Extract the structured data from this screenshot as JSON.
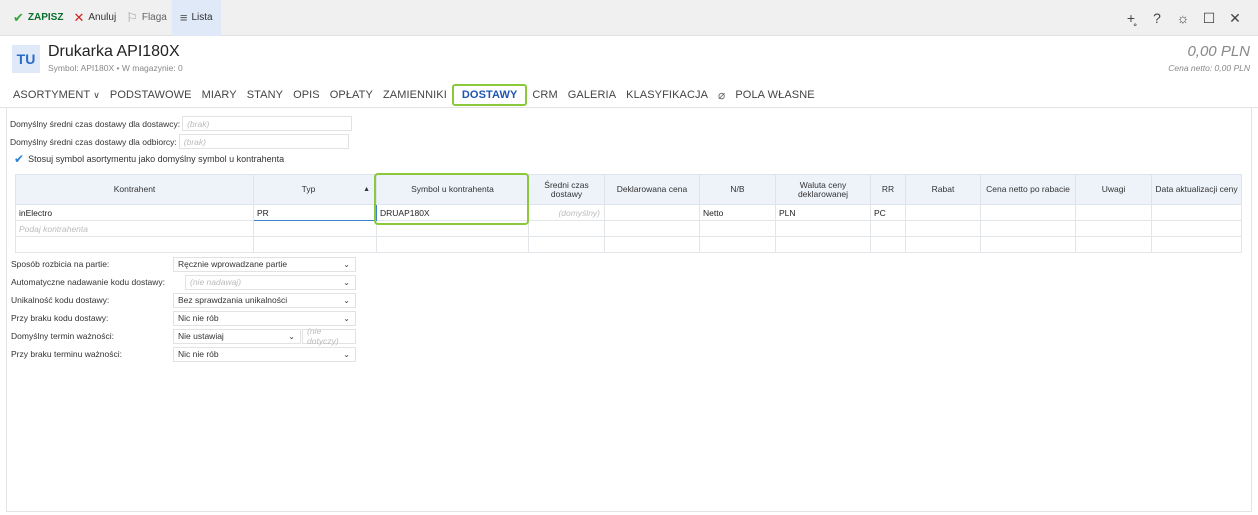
{
  "toolbar": {
    "save": "ZAPISZ",
    "cancel": "Anuluj",
    "flag": "Flaga",
    "list": "Lista"
  },
  "header": {
    "avatar": "TU",
    "title": "Drukarka API180X",
    "subtitle": "Symbol: API180X • W magazynie: 0",
    "price": "0,00 PLN",
    "price_sub": "Cena netto: 0,00 PLN"
  },
  "tabs": [
    "ASORTYMENT",
    "PODSTAWOWE",
    "MIARY",
    "STANY",
    "OPIS",
    "OPŁATY",
    "ZAMIENNIKI",
    "DOSTAWY",
    "CRM",
    "GALERIA",
    "KLASYFIKACJA",
    "POLA WŁASNE"
  ],
  "settings": {
    "supplier_time_label": "Domyślny średni czas dostawy dla dostawcy:",
    "supplier_time_value": "(brak)",
    "receiver_time_label": "Domyślny średni czas dostawy dla odbiorcy:",
    "receiver_time_value": "(brak)",
    "use_symbol_label": "Stosuj symbol asortymentu jako domyślny symbol u kontrahenta"
  },
  "table": {
    "headers": [
      "Kontrahent",
      "Typ",
      "Symbol u kontrahenta",
      "Średni czas dostawy",
      "Deklarowana cena",
      "N/B",
      "Waluta ceny deklarowanej",
      "RR",
      "Rabat",
      "Cena netto po rabacie",
      "Uwagi",
      "Data aktualizacji ceny"
    ],
    "row": {
      "kontrahent": "inElectro",
      "typ": "PR",
      "symbol": "DRUAP180X",
      "czas": "(domyślny)",
      "nb": "Netto",
      "waluta": "PLN",
      "rr": "PC"
    },
    "placeholder": "Podaj kontrahenta"
  },
  "form": {
    "rows": [
      {
        "label": "Sposób rozbicia na partie:",
        "value": "Ręcznie wprowadzane partie"
      },
      {
        "label": "Automatyczne nadawanie kodu dostawy:",
        "value": "(nie nadawaj)"
      },
      {
        "label": "Unikalność kodu dostawy:",
        "value": "Bez sprawdzania unikalności"
      },
      {
        "label": "Przy braku kodu dostawy:",
        "value": "Nic nie rób"
      },
      {
        "label": "Domyślny termin ważności:",
        "value": "Nie ustawiaj",
        "extra": "(nie dotyczy)"
      },
      {
        "label": "Przy braku terminu ważności:",
        "value": "Nic nie rób"
      }
    ]
  }
}
